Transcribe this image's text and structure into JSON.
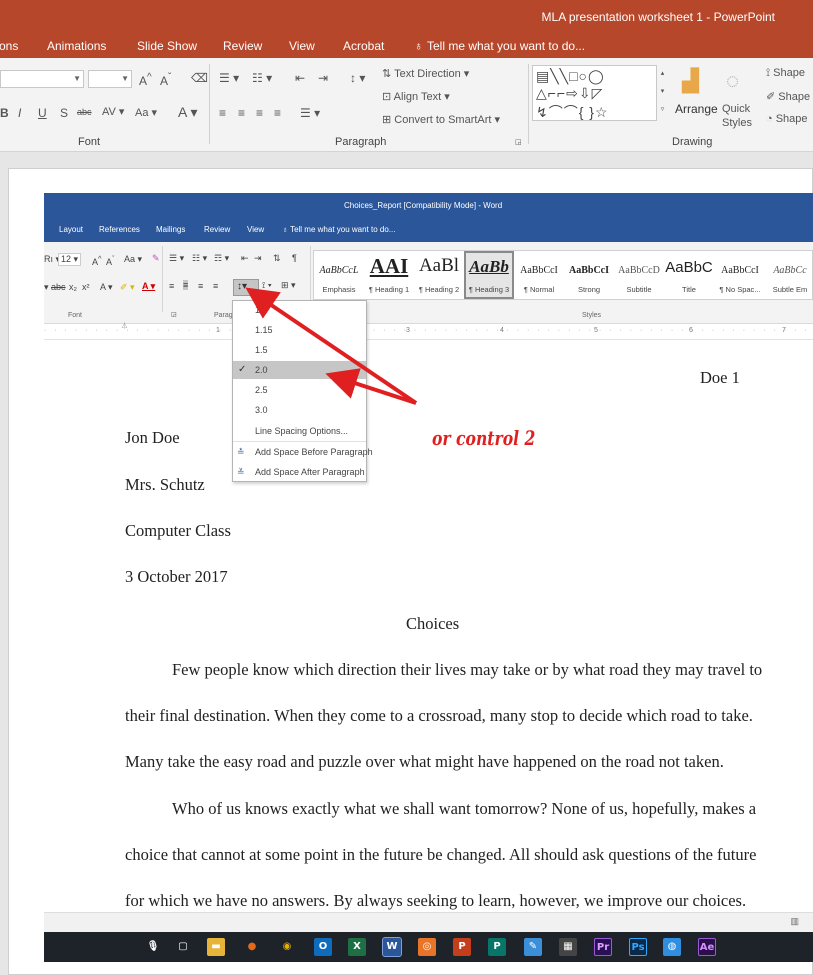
{
  "powerpoint": {
    "title": "MLA presentation worksheet 1 - PowerPoint",
    "tabs": [
      "ons",
      "Animations",
      "Slide Show",
      "Review",
      "View",
      "Acrobat"
    ],
    "tell_me": "Tell me what you want to do...",
    "ribbon": {
      "text_direction": "Text Direction",
      "align_text": "Align Text",
      "convert_smartart": "Convert to SmartArt",
      "arrange": "Arrange",
      "quick_styles": "Quick Styles",
      "shape1": "Shape",
      "shape2": "Shape",
      "shape3": "Shape",
      "font_label": "Font",
      "paragraph_label": "Paragraph",
      "drawing_label": "Drawing"
    }
  },
  "word": {
    "title": "Choices_Report [Compatibility Mode] - Word",
    "tabs": [
      "Layout",
      "References",
      "Mailings",
      "Review",
      "View"
    ],
    "tell_me": "Tell me what you want to do...",
    "font_size": "12",
    "font_label": "Font",
    "paragraph_label": "Parag",
    "styles_label": "Styles",
    "styles": [
      {
        "preview": "AaBbCcL",
        "name": "Emphasis"
      },
      {
        "preview": "AAI",
        "name": "¶ Heading 1"
      },
      {
        "preview": "AaBl",
        "name": "¶ Heading 2"
      },
      {
        "preview": "AaBb",
        "name": "¶ Heading 3"
      },
      {
        "preview": "AaBbCcI",
        "name": "¶ Normal"
      },
      {
        "preview": "AaBbCcI",
        "name": "Strong"
      },
      {
        "preview": "AaBbCcD",
        "name": "Subtitle"
      },
      {
        "preview": "AaBbC",
        "name": "Title"
      },
      {
        "preview": "AaBbCcI",
        "name": "¶ No Spac..."
      },
      {
        "preview": "AaBbCc",
        "name": "Subtle Em"
      }
    ],
    "ruler_marks": [
      "1",
      "3",
      "4",
      "5",
      "6",
      "7"
    ],
    "line_spacing_menu": {
      "options": [
        "1.0",
        "1.15",
        "1.5",
        "2.0",
        "2.5",
        "3.0"
      ],
      "selected": "2.0",
      "line_spacing_options": "Line Spacing Options...",
      "add_before": "Add Space Before Paragraph",
      "add_after": "Add Space After Paragraph"
    },
    "document": {
      "header_right": "Doe 1",
      "name": "Jon Doe",
      "teacher": "Mrs. Schutz",
      "class": "Computer Class",
      "date": "3 October 2017",
      "title": "Choices",
      "lines": [
        "Few people know which direction their lives may take or by what road they may travel to",
        "their final destination.  When they come to a crossroad, many stop to decide which road to take.",
        "Many take the easy road and puzzle over what might have happened on the road not taken.",
        "Who of us knows exactly what we shall want tomorrow?  None of us, hopefully, makes a",
        "choice that cannot at some point in the future be changed.  All should ask questions of the future",
        "for which we have no answers.  By always seeking to learn, however, we improve our choices."
      ]
    }
  },
  "annotation": {
    "text": "or control 2",
    "color": "#e02020"
  },
  "taskbar": {
    "icons": [
      {
        "name": "microphone-icon",
        "glyph": "🎙",
        "color": "#1e2229"
      },
      {
        "name": "task-view-icon",
        "glyph": "▢",
        "color": "#1e2229"
      },
      {
        "name": "file-explorer-icon",
        "glyph": "▬",
        "color": "#e8b339"
      },
      {
        "name": "firefox-icon",
        "glyph": "●",
        "color": "#e06a1a"
      },
      {
        "name": "chrome-icon",
        "glyph": "◉",
        "color": "#e8b000"
      },
      {
        "name": "outlook-icon",
        "glyph": "O",
        "color": "#0f6cbd"
      },
      {
        "name": "excel-icon",
        "glyph": "X",
        "color": "#1d7044"
      },
      {
        "name": "word-icon",
        "glyph": "W",
        "color": "#2b579a"
      },
      {
        "name": "app-orange-icon",
        "glyph": "◎",
        "color": "#e8742a"
      },
      {
        "name": "powerpoint-icon",
        "glyph": "P",
        "color": "#c43e1c"
      },
      {
        "name": "publisher-icon",
        "glyph": "P",
        "color": "#077568"
      },
      {
        "name": "notepad-icon",
        "glyph": "✎",
        "color": "#3a8fd8"
      },
      {
        "name": "calculator-icon",
        "glyph": "▦",
        "color": "#444"
      },
      {
        "name": "premiere-icon",
        "glyph": "Pr",
        "color": "#2a1155"
      },
      {
        "name": "photoshop-icon",
        "glyph": "Ps",
        "color": "#0b2a4a"
      },
      {
        "name": "globe-icon",
        "glyph": "◍",
        "color": "#2f8ee0"
      },
      {
        "name": "after-effects-icon",
        "glyph": "Ae",
        "color": "#2a0f4a"
      }
    ]
  }
}
